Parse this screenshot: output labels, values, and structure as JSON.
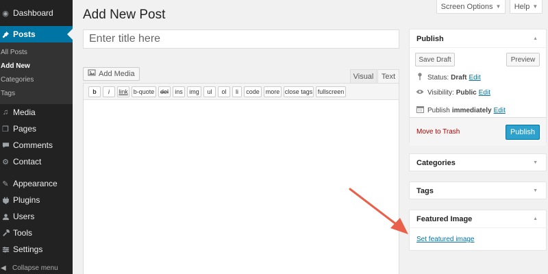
{
  "sidebar": {
    "items": [
      {
        "label": "Dashboard",
        "icon": "dashboard-icon",
        "glyph": "◉"
      },
      {
        "label": "Posts",
        "icon": "pin-icon",
        "glyph": "✉"
      },
      {
        "label": "Media",
        "icon": "media-icon",
        "glyph": "♫"
      },
      {
        "label": "Pages",
        "icon": "pages-icon",
        "glyph": "❐"
      },
      {
        "label": "Comments",
        "icon": "comments-icon",
        "glyph": "✉"
      },
      {
        "label": "Contact",
        "icon": "contact-icon",
        "glyph": "⚙"
      },
      {
        "label": "Appearance",
        "icon": "paintbrush-icon",
        "glyph": "✎"
      },
      {
        "label": "Plugins",
        "icon": "plugin-icon",
        "glyph": "⚒"
      },
      {
        "label": "Users",
        "icon": "users-icon",
        "glyph": "☺"
      },
      {
        "label": "Tools",
        "icon": "wrench-icon",
        "glyph": "⚒"
      },
      {
        "label": "Settings",
        "icon": "settings-icon",
        "glyph": "☰"
      }
    ],
    "submenu": [
      "All Posts",
      "Add New",
      "Categories",
      "Tags"
    ],
    "collapse_label": "Collapse menu"
  },
  "top": {
    "screen_options": "Screen Options",
    "help": "Help"
  },
  "main": {
    "page_title": "Add New Post",
    "title_placeholder": "Enter title here",
    "add_media": "Add Media",
    "tab_visual": "Visual",
    "tab_text": "Text",
    "quicktags": [
      "b",
      "i",
      "link",
      "b-quote",
      "del",
      "ins",
      "img",
      "ul",
      "ol",
      "li",
      "code",
      "more",
      "close tags",
      "fullscreen"
    ]
  },
  "publish": {
    "title": "Publish",
    "save_draft": "Save Draft",
    "preview": "Preview",
    "status_label": "Status:",
    "status_value": "Draft",
    "visibility_label": "Visibility:",
    "visibility_value": "Public",
    "publish_label": "Publish",
    "publish_value": "immediately",
    "edit": "Edit",
    "move_to_trash": "Move to Trash",
    "publish_button": "Publish"
  },
  "categories": {
    "title": "Categories"
  },
  "tags": {
    "title": "Tags"
  },
  "featured": {
    "title": "Featured Image",
    "link": "Set featured image"
  },
  "colors": {
    "accent": "#0074a2",
    "button_primary": "#2ea2cc",
    "sidebar": "#222222",
    "arrow": "#e9614a"
  }
}
